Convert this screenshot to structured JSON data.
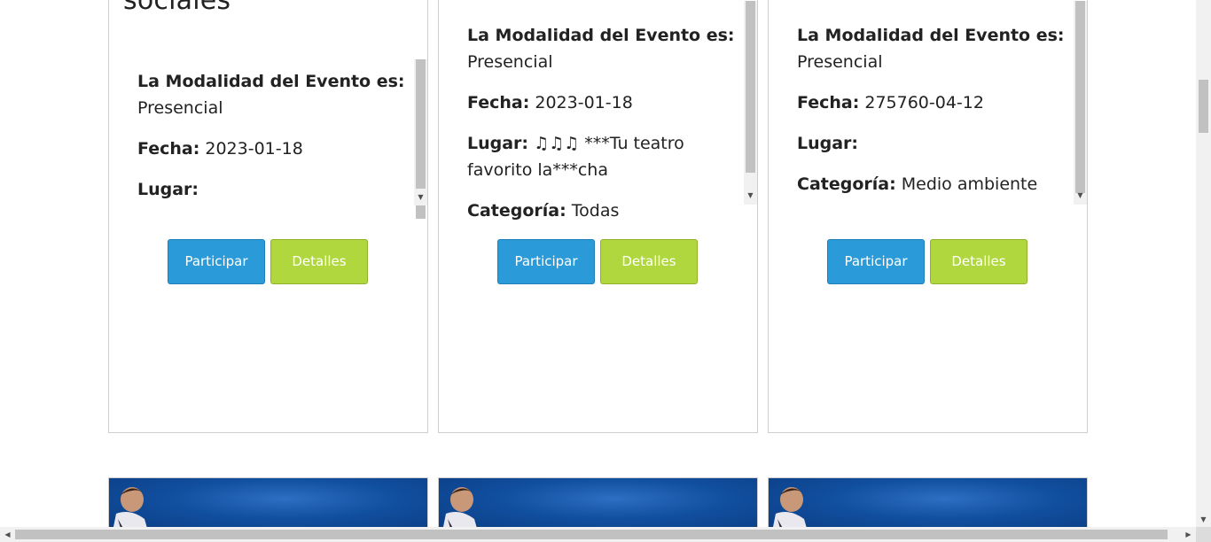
{
  "cards": [
    {
      "title": "sociales",
      "modalidad_label": "La Modalidad del Evento es:",
      "modalidad_value": "Presencial",
      "fecha_label": "Fecha:",
      "fecha_value": "2023-01-18",
      "lugar_label": "Lugar:",
      "lugar_value": "",
      "participar_label": "Participar",
      "detalles_label": "Detalles"
    },
    {
      "modalidad_label": "La Modalidad del Evento es:",
      "modalidad_value": "Presencial",
      "fecha_label": "Fecha:",
      "fecha_value": "2023-01-18",
      "lugar_label": "Lugar:",
      "lugar_value": "♫♫♫ ***Tu teatro favorito la***cha",
      "categoria_label": "Categoría:",
      "categoria_value": "Todas",
      "participar_label": "Participar",
      "detalles_label": "Detalles"
    },
    {
      "modalidad_label": "La Modalidad del Evento es:",
      "modalidad_value": "Presencial",
      "fecha_label": "Fecha:",
      "fecha_value": "275760-04-12",
      "lugar_label": "Lugar:",
      "lugar_value": "",
      "categoria_label": "Categoría:",
      "categoria_value": "Medio ambiente",
      "participar_label": "Participar",
      "detalles_label": "Detalles"
    }
  ],
  "icons": {
    "scroll_up": "triangle-up-icon",
    "scroll_down": "triangle-down-icon",
    "scroll_left": "triangle-left-icon",
    "scroll_right": "triangle-right-icon"
  },
  "colors": {
    "participar_bg": "#2a9bd8",
    "detalles_bg": "#b0d83e",
    "banner_blue": "#114f9f"
  }
}
